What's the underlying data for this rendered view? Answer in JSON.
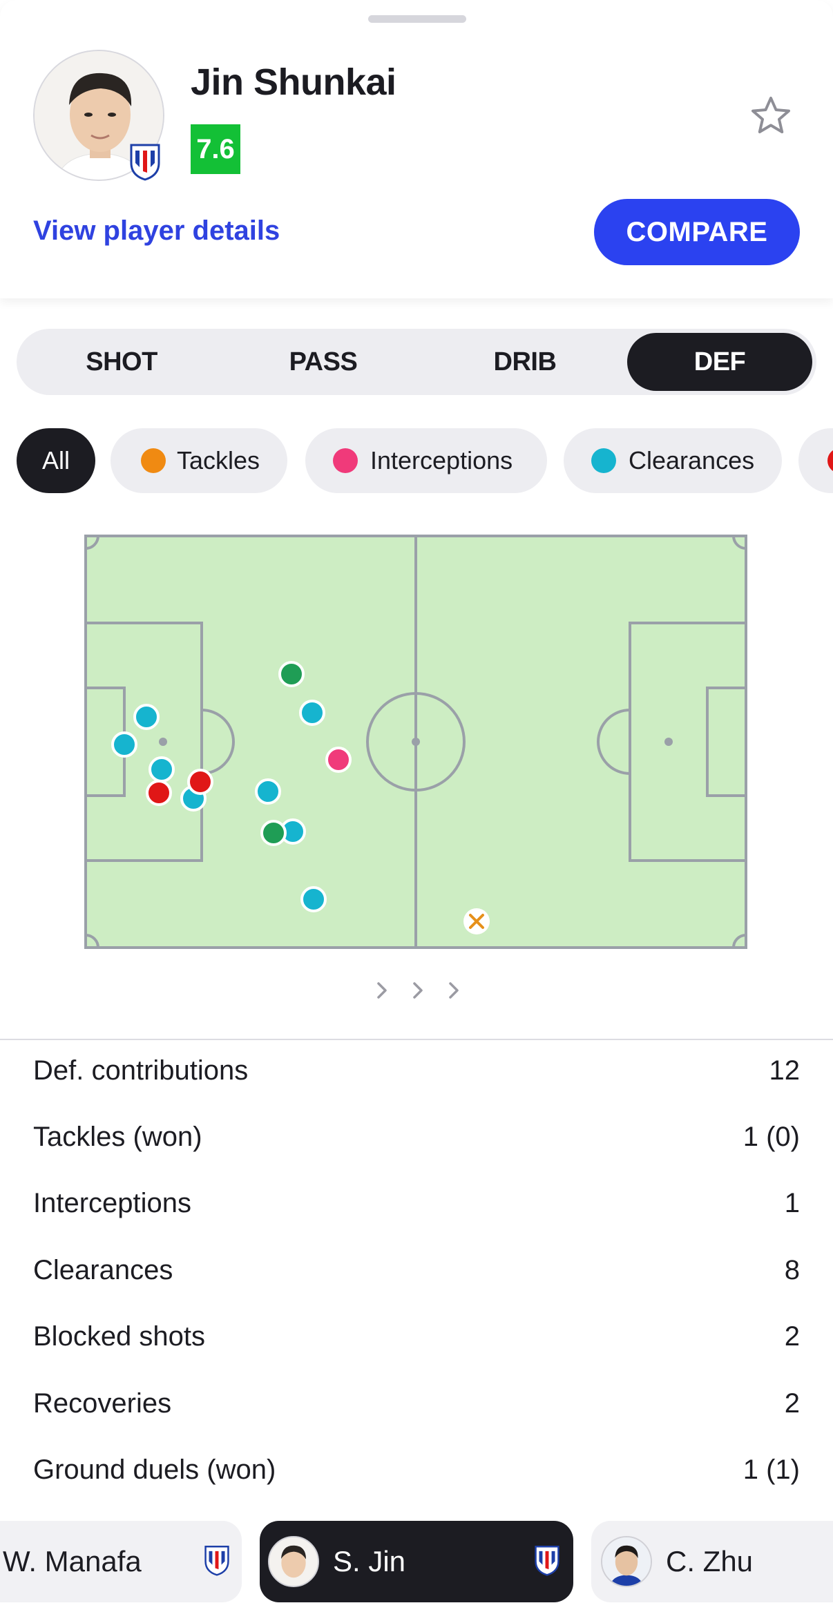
{
  "player": {
    "name": "Jin Shunkai",
    "rating": "7.6",
    "rating_color": "#13c036",
    "details_link": "View player details",
    "compare_label": "COMPARE"
  },
  "tabs": [
    {
      "label": "SHOT",
      "active": false
    },
    {
      "label": "PASS",
      "active": false
    },
    {
      "label": "DRIB",
      "active": false
    },
    {
      "label": "DEF",
      "active": true
    }
  ],
  "filters": [
    {
      "label": "All",
      "active": true
    },
    {
      "label": "Tackles",
      "color": "#f08a12"
    },
    {
      "label": "Interceptions",
      "color": "#f03a7a"
    },
    {
      "label": "Clearances",
      "color": "#16b4cf"
    },
    {
      "label": "",
      "color": "#e01717"
    }
  ],
  "pitch": {
    "colors": {
      "grass": "#cdedc3",
      "lines": "#9aa0a8",
      "clearance": "#16b4cf",
      "interception": "#f03a7a",
      "blocked": "#e01717",
      "recovery": "#1f9d55",
      "marker": "#e6901a"
    }
  },
  "stats": [
    {
      "label": "Def. contributions",
      "value": "12"
    },
    {
      "label": "Tackles (won)",
      "value": "1 (0)"
    },
    {
      "label": "Interceptions",
      "value": "1"
    },
    {
      "label": "Clearances",
      "value": "8"
    },
    {
      "label": "Blocked shots",
      "value": "2"
    },
    {
      "label": "Recoveries",
      "value": "2"
    },
    {
      "label": "Ground duels (won)",
      "value": "1 (1)"
    }
  ],
  "switcher": [
    {
      "name": "W. Manafa"
    },
    {
      "name": "S. Jin",
      "active": true
    },
    {
      "name": "C. Zhu"
    }
  ]
}
